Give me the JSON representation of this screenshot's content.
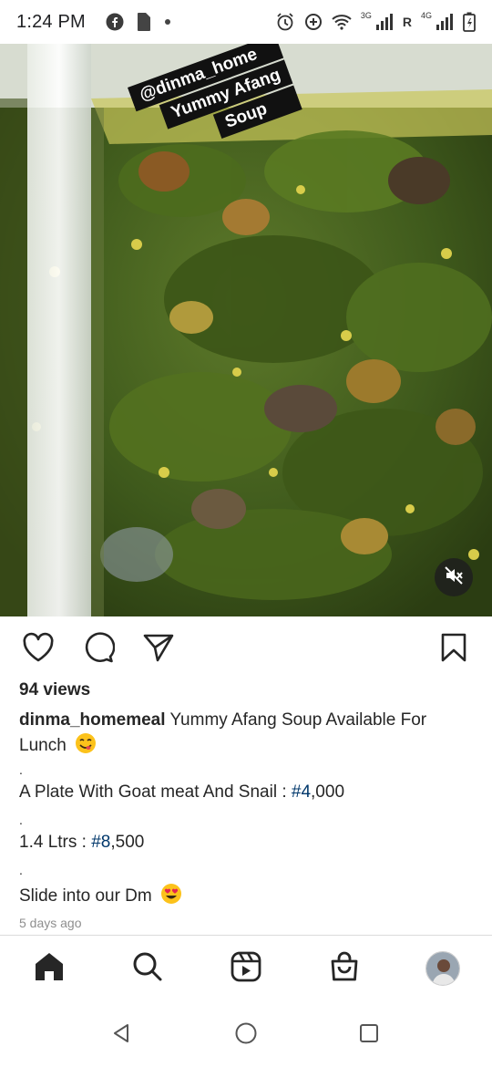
{
  "status_bar": {
    "time": "1:24 PM",
    "left_icons": [
      "facebook-icon",
      "sim-card-icon",
      "dot-icon"
    ],
    "right_icons": [
      "alarm-icon",
      "data-saver-icon",
      "wifi-icon",
      "signal-icon",
      "signal-icon",
      "battery-icon"
    ],
    "network_labels": [
      "3G",
      "R",
      "4G"
    ]
  },
  "media": {
    "sticker_lines": [
      "@dinma_home",
      "Yummy Afang",
      "Soup"
    ],
    "mute_icon": "volume-muted-icon"
  },
  "actions": {
    "like_icon": "heart-icon",
    "comment_icon": "comment-icon",
    "share_icon": "send-icon",
    "save_icon": "bookmark-icon"
  },
  "post": {
    "views": "94 views",
    "username": "dinma_homemeal",
    "caption_text": "Yummy Afang Soup Available For Lunch",
    "dot": ".",
    "line1_prefix": "A Plate With Goat meat And Snail : ",
    "line1_hashtag": "#4",
    "line1_suffix": ",000",
    "line2_prefix": "1.4 Ltrs : ",
    "line2_hashtag": "#8",
    "line2_suffix": ",500",
    "line3": "Slide into our Dm",
    "timestamp": "5 days ago"
  },
  "bottom_nav": {
    "items": [
      "home-icon",
      "search-icon",
      "reels-icon",
      "shop-icon",
      "profile-avatar"
    ]
  },
  "system_nav": {
    "items": [
      "back-icon",
      "home-circle-icon",
      "recents-icon"
    ]
  },
  "colors": {
    "hashtag": "#00376b",
    "text": "#262626",
    "muted": "#8e8e8e"
  }
}
